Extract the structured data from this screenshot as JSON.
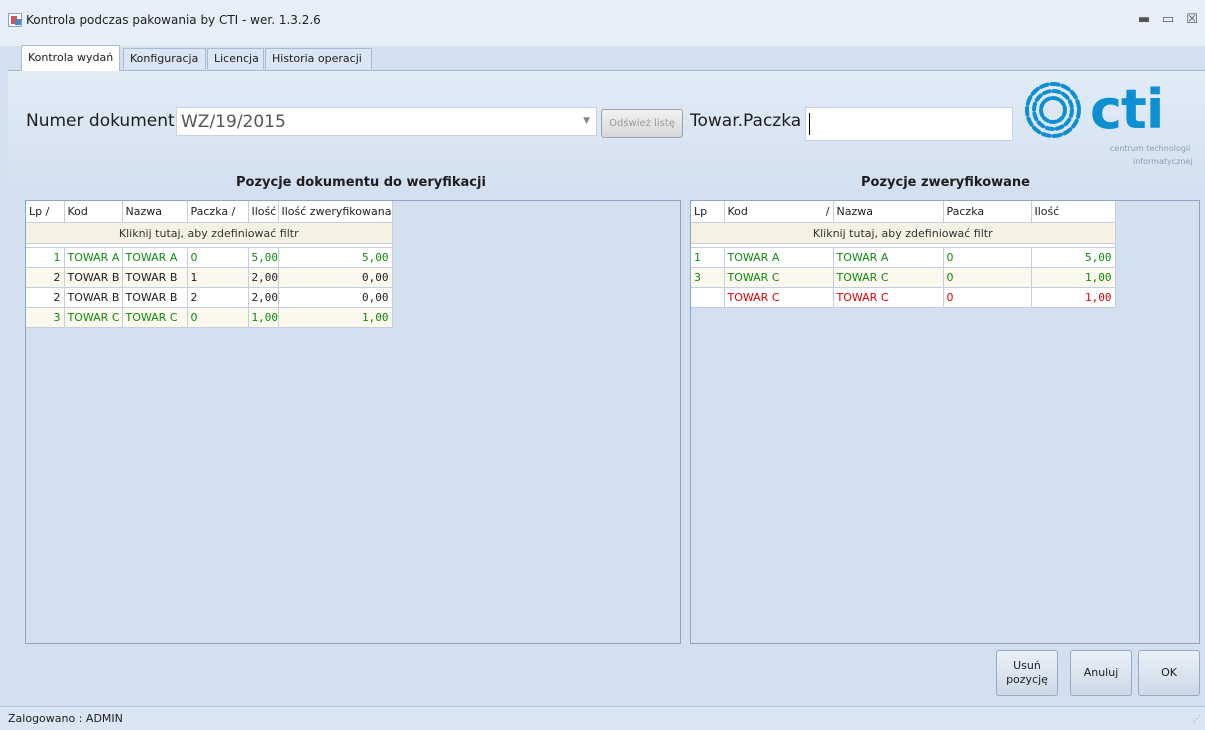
{
  "window": {
    "title": "Kontrola podczas pakowania by CTI -  wer. 1.3.2.6",
    "minimize": "▬",
    "maximize": "▭",
    "close": "☒"
  },
  "tabs": [
    {
      "label": "Kontrola wydań",
      "active": true
    },
    {
      "label": "Konfiguracja",
      "active": false
    },
    {
      "label": "Licencja",
      "active": false
    },
    {
      "label": "Historia operacji",
      "active": false
    }
  ],
  "document": {
    "label": "Numer dokumentu",
    "value": "WZ/19/2015",
    "refresh_label": "Odśwież listę"
  },
  "towar": {
    "label": "Towar.Paczka",
    "value": ""
  },
  "logo": {
    "text": "cti",
    "sub1": "centrum technologii",
    "sub2": "informatycznej",
    "color": "#0d8fd1"
  },
  "left_grid": {
    "title": "Pozycje dokumentu do weryfikacji",
    "headers": [
      "Lp  /",
      "Kod",
      "Nazwa",
      "Paczka  /",
      "Ilość",
      "Ilość zweryfikowana"
    ],
    "filter": "Kliknij tutaj, aby zdefiniować filtr",
    "rows": [
      {
        "lp": "1",
        "kod": "TOWAR A",
        "nazwa": "TOWAR A",
        "paczka": "0",
        "ilosc": "5,00",
        "zweryfikowana": "5,00",
        "status": "green"
      },
      {
        "lp": "2",
        "kod": "TOWAR B",
        "nazwa": "TOWAR B",
        "paczka": "1",
        "ilosc": "2,00",
        "zweryfikowana": "0,00",
        "status": "black"
      },
      {
        "lp": "2",
        "kod": "TOWAR B",
        "nazwa": "TOWAR B",
        "paczka": "2",
        "ilosc": "2,00",
        "zweryfikowana": "0,00",
        "status": "black"
      },
      {
        "lp": "3",
        "kod": "TOWAR C",
        "nazwa": "TOWAR C",
        "paczka": "0",
        "ilosc": "1,00",
        "zweryfikowana": "1,00",
        "status": "green"
      }
    ]
  },
  "right_grid": {
    "title": "Pozycje zweryfikowane",
    "headers": [
      "Lp",
      "Kod",
      "/",
      "Nazwa",
      "Paczka",
      "Ilość"
    ],
    "filter": "Kliknij tutaj, aby zdefiniować filtr",
    "rows": [
      {
        "lp": "1",
        "kod": "TOWAR A",
        "nazwa": "TOWAR A",
        "paczka": "0",
        "ilosc": "5,00",
        "status": "green"
      },
      {
        "lp": "3",
        "kod": "TOWAR C",
        "nazwa": "TOWAR C",
        "paczka": "0",
        "ilosc": "1,00",
        "status": "green"
      },
      {
        "lp": "",
        "kod": "TOWAR C",
        "nazwa": "TOWAR C",
        "paczka": "0",
        "ilosc": "1,00",
        "status": "red"
      }
    ]
  },
  "buttons": {
    "usun_line1": "Usuń",
    "usun_line2": "pozycję",
    "anuluj": "Anuluj",
    "ok": "OK"
  },
  "status": {
    "text": "Zalogowano : ADMIN"
  },
  "colors": {
    "ok": "#0e8a0e",
    "error": "#e00000",
    "accent": "#0d8fd1"
  }
}
